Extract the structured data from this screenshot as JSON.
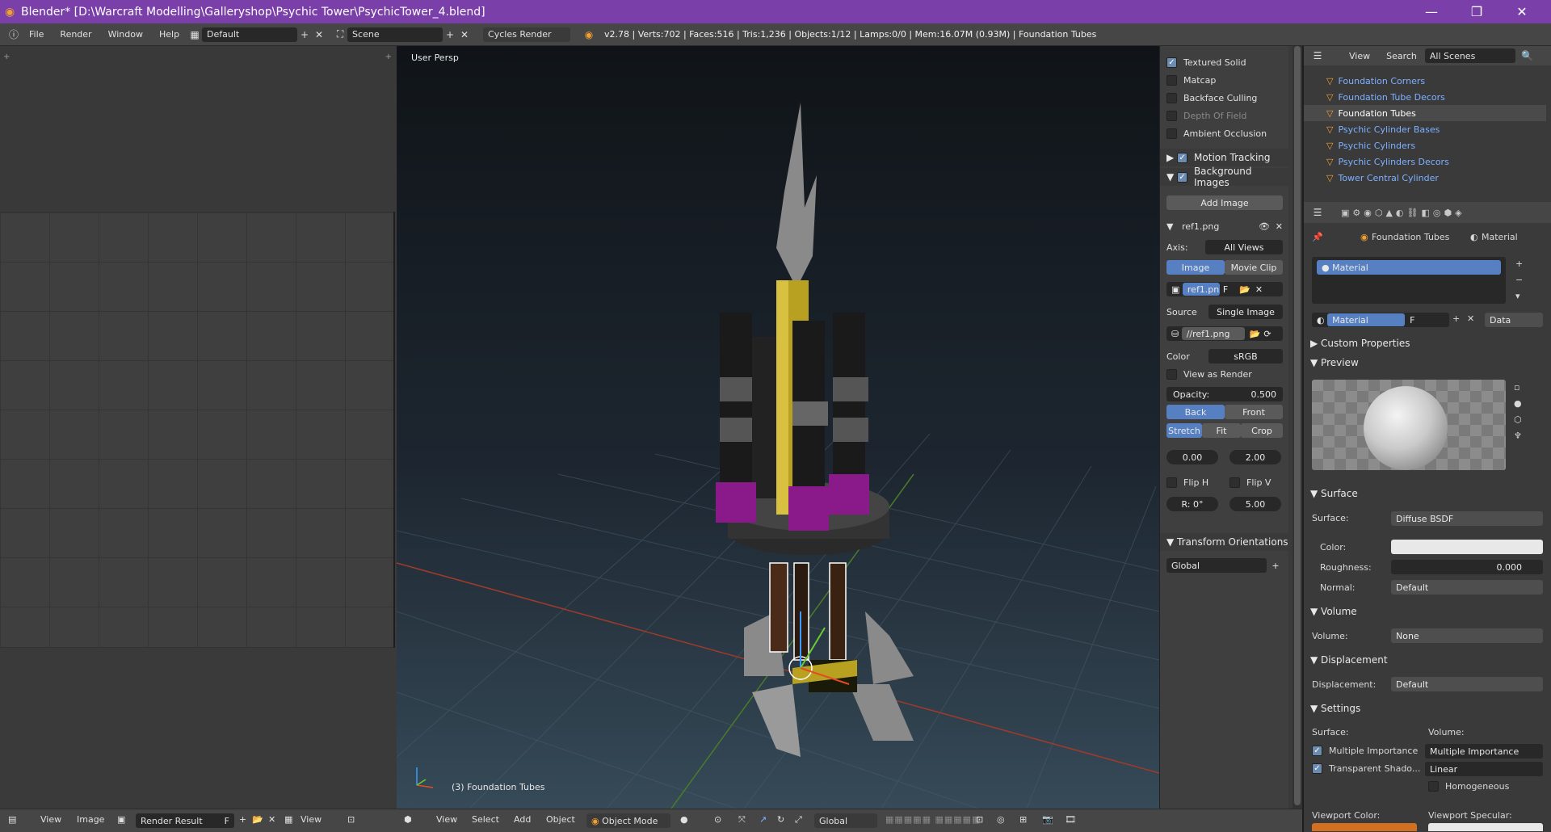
{
  "window": {
    "title": "Blender* [D:\\Warcraft Modelling\\Galleryshop\\Psychic Tower\\PsychicTower_4.blend]",
    "minimize": "—",
    "maximize": "❐",
    "close": "✕"
  },
  "info_header": {
    "menus": [
      "File",
      "Render",
      "Window",
      "Help"
    ],
    "layout": "Default",
    "scene": "Scene",
    "engine": "Cycles Render",
    "stats": "v2.78 | Verts:702 | Faces:516 | Tris:1,236 | Objects:1/12 | Lamps:0/0 | Mem:16.07M (0.93M) | Foundation Tubes"
  },
  "viewport": {
    "view_label": "User Persp",
    "object_label": "(3) Foundation Tubes"
  },
  "npanel": {
    "display_options": [
      {
        "label": "Textured Solid",
        "checked": true
      },
      {
        "label": "Matcap",
        "checked": false
      },
      {
        "label": "Backface Culling",
        "checked": false
      },
      {
        "label": "Depth Of Field",
        "checked": false
      },
      {
        "label": "Ambient Occlusion",
        "checked": false
      }
    ],
    "motion_tracking": "Motion Tracking",
    "background_images": "Background Images",
    "add_image": "Add Image",
    "image_name": "ref1.png",
    "axis_label": "Axis:",
    "axis_value": "All Views",
    "tab_image": "Image",
    "tab_movie": "Movie Clip",
    "image_field": "ref1.pn",
    "image_field_f": "F",
    "source_label": "Source",
    "source_value": "Single Image",
    "filepath": "//ref1.png",
    "color_label": "Color",
    "color_value": "sRGB",
    "view_as_render": "View as Render",
    "opacity_label": "Opacity:",
    "opacity_value": "0.500",
    "back": "Back",
    "front": "Front",
    "stretch": "Stretch",
    "fit": "Fit",
    "crop": "Crop",
    "offset_x": "0.00",
    "offset_y": "2.00",
    "flip_h": "Flip H",
    "flip_v": "Flip V",
    "rotation": "R: 0°",
    "size": "5.00",
    "transform_orientations": "Transform Orientations",
    "orientation_value": "Global"
  },
  "outliner": {
    "view": "View",
    "search": "Search",
    "scenes": "All Scenes",
    "items": [
      {
        "name": "Foundation Corners",
        "active": false
      },
      {
        "name": "Foundation Tube Decors",
        "active": false
      },
      {
        "name": "Foundation Tubes",
        "active": true
      },
      {
        "name": "Psychic Cylinder Bases",
        "active": false
      },
      {
        "name": "Psychic Cylinders",
        "active": false
      },
      {
        "name": "Psychic Cylinders Decors",
        "active": false
      },
      {
        "name": "Tower Central Cylinder",
        "active": false
      }
    ]
  },
  "properties": {
    "breadcrumb_object": "Foundation Tubes",
    "breadcrumb_material": "Material",
    "slot_name": "Material",
    "material_name": "Material",
    "material_f": "F",
    "link": "Data",
    "custom_properties": "Custom Properties",
    "preview": "Preview",
    "surface_panel": "Surface",
    "surface_label": "Surface:",
    "surface_value": "Diffuse BSDF",
    "color_label": "Color:",
    "roughness_label": "Roughness:",
    "roughness_value": "0.000",
    "normal_label": "Normal:",
    "normal_value": "Default",
    "volume_panel": "Volume",
    "volume_label": "Volume:",
    "volume_value": "None",
    "displacement_panel": "Displacement",
    "displacement_label": "Displacement:",
    "displacement_value": "Default",
    "settings_panel": "Settings",
    "settings_surface": "Surface:",
    "settings_volume": "Volume:",
    "multiple_importance": "Multiple Importance",
    "transparent_shadows": "Transparent Shado...",
    "volume_sampling": "Multiple Importance",
    "interpolation": "Linear",
    "homogeneous": "Homogeneous",
    "viewport_color": "Viewport Color:",
    "viewport_specular": "Viewport Specular:"
  },
  "bottom_bar": {
    "left_view": "View",
    "left_image": "Image",
    "render_result": "Render Result",
    "render_f": "F",
    "left_view2": "View",
    "vp_view": "View",
    "vp_select": "Select",
    "vp_add": "Add",
    "vp_object": "Object",
    "mode": "Object Mode",
    "orientation": "Global"
  },
  "colors": {
    "title_bar": "#7a3fa8",
    "accent": "#5680c2",
    "object_purple": "#8a1a8a",
    "object_yellow": "#b8a020"
  }
}
